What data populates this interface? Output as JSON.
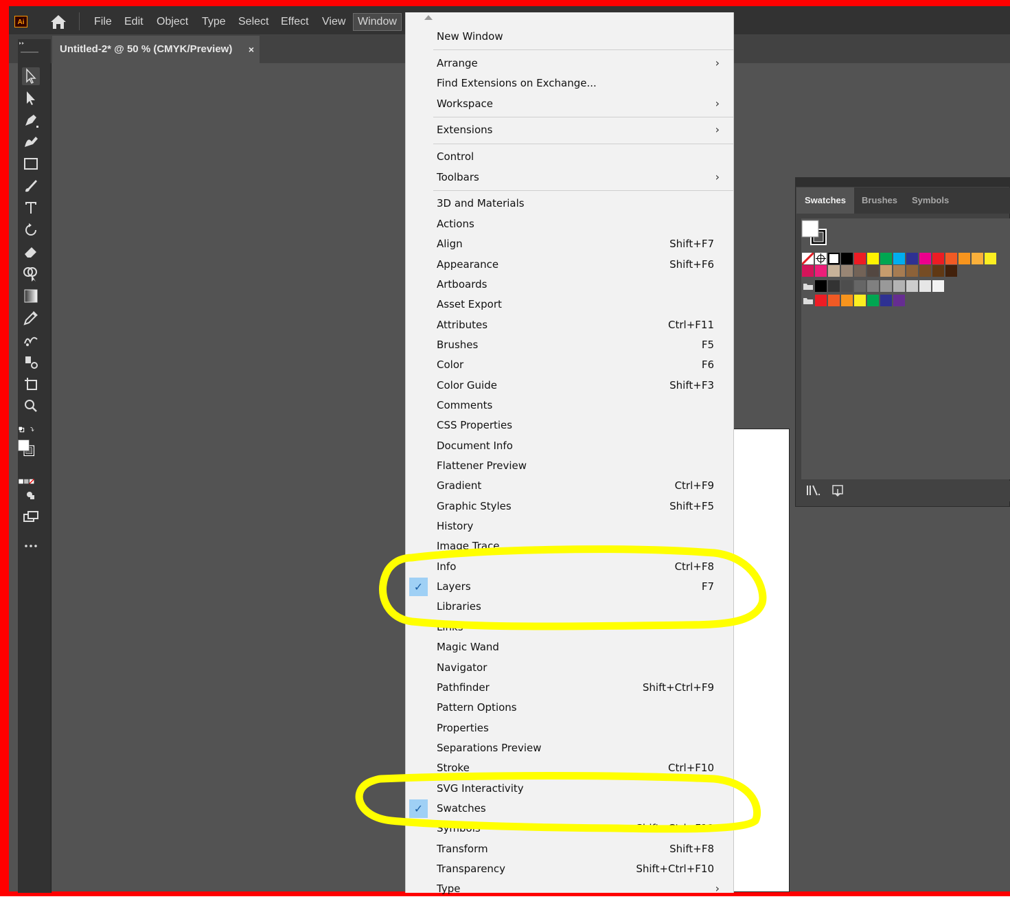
{
  "app": {
    "logo_text": "Ai",
    "menu": [
      "File",
      "Edit",
      "Object",
      "Type",
      "Select",
      "Effect",
      "View",
      "Window"
    ]
  },
  "document_tab": {
    "title": "Untitled-2* @ 50 % (CMYK/Preview)",
    "close": "×"
  },
  "swatches_panel": {
    "tabs": [
      "Swatches",
      "Brushes",
      "Symbols"
    ],
    "colors_row1": [
      "#e31e24",
      "#ffffff",
      "#ffffff",
      "#000000",
      "#ed1c24",
      "#fff200",
      "#00a651",
      "#00aeef",
      "#2e3192",
      "#ec008c",
      "#ed1c24",
      "#f15a24",
      "#f7941d",
      "#fbb03b",
      "#fcee21"
    ],
    "colors_row2": [
      "#d4145a",
      "#ed1e79",
      "#c7b299",
      "#998675",
      "#736357",
      "#534741",
      "#c69c6d",
      "#a67c52",
      "#8c6239",
      "#754c24",
      "#603813",
      "#42210b"
    ],
    "colors_row3": [
      "#000000",
      "#333333",
      "#4d4d4d",
      "#666666",
      "#808080",
      "#999999",
      "#b3b3b3",
      "#cccccc",
      "#e6e6e6",
      "#f2f2f2"
    ],
    "colors_row4": [
      "#ed1c24",
      "#f15a24",
      "#f7941d",
      "#fcee21",
      "#00a651",
      "#2e3192",
      "#662d91"
    ]
  },
  "window_menu": {
    "items": [
      {
        "label": "New Window",
        "shortcut": "",
        "submenu": false,
        "checked": false
      },
      {
        "label": "Arrange",
        "shortcut": "",
        "submenu": true,
        "checked": false
      },
      {
        "label": "Find Extensions on Exchange...",
        "shortcut": "",
        "submenu": false,
        "checked": false
      },
      {
        "label": "Workspace",
        "shortcut": "",
        "submenu": true,
        "checked": false
      },
      {
        "label": "Extensions",
        "shortcut": "",
        "submenu": true,
        "checked": false
      },
      {
        "label": "Control",
        "shortcut": "",
        "submenu": false,
        "checked": false
      },
      {
        "label": "Toolbars",
        "shortcut": "",
        "submenu": true,
        "checked": false
      },
      {
        "label": "3D and Materials",
        "shortcut": "",
        "submenu": false,
        "checked": false
      },
      {
        "label": "Actions",
        "shortcut": "",
        "submenu": false,
        "checked": false
      },
      {
        "label": "Align",
        "shortcut": "Shift+F7",
        "submenu": false,
        "checked": false
      },
      {
        "label": "Appearance",
        "shortcut": "Shift+F6",
        "submenu": false,
        "checked": false
      },
      {
        "label": "Artboards",
        "shortcut": "",
        "submenu": false,
        "checked": false
      },
      {
        "label": "Asset Export",
        "shortcut": "",
        "submenu": false,
        "checked": false
      },
      {
        "label": "Attributes",
        "shortcut": "Ctrl+F11",
        "submenu": false,
        "checked": false
      },
      {
        "label": "Brushes",
        "shortcut": "F5",
        "submenu": false,
        "checked": false
      },
      {
        "label": "Color",
        "shortcut": "F6",
        "submenu": false,
        "checked": false
      },
      {
        "label": "Color Guide",
        "shortcut": "Shift+F3",
        "submenu": false,
        "checked": false
      },
      {
        "label": "Comments",
        "shortcut": "",
        "submenu": false,
        "checked": false
      },
      {
        "label": "CSS Properties",
        "shortcut": "",
        "submenu": false,
        "checked": false
      },
      {
        "label": "Document Info",
        "shortcut": "",
        "submenu": false,
        "checked": false
      },
      {
        "label": "Flattener Preview",
        "shortcut": "",
        "submenu": false,
        "checked": false
      },
      {
        "label": "Gradient",
        "shortcut": "Ctrl+F9",
        "submenu": false,
        "checked": false
      },
      {
        "label": "Graphic Styles",
        "shortcut": "Shift+F5",
        "submenu": false,
        "checked": false
      },
      {
        "label": "History",
        "shortcut": "",
        "submenu": false,
        "checked": false
      },
      {
        "label": "Image Trace",
        "shortcut": "",
        "submenu": false,
        "checked": false
      },
      {
        "label": "Info",
        "shortcut": "Ctrl+F8",
        "submenu": false,
        "checked": false
      },
      {
        "label": "Layers",
        "shortcut": "F7",
        "submenu": false,
        "checked": true
      },
      {
        "label": "Libraries",
        "shortcut": "",
        "submenu": false,
        "checked": false
      },
      {
        "label": "Links",
        "shortcut": "",
        "submenu": false,
        "checked": false
      },
      {
        "label": "Magic Wand",
        "shortcut": "",
        "submenu": false,
        "checked": false
      },
      {
        "label": "Navigator",
        "shortcut": "",
        "submenu": false,
        "checked": false
      },
      {
        "label": "Pathfinder",
        "shortcut": "Shift+Ctrl+F9",
        "submenu": false,
        "checked": false
      },
      {
        "label": "Pattern Options",
        "shortcut": "",
        "submenu": false,
        "checked": false
      },
      {
        "label": "Properties",
        "shortcut": "",
        "submenu": false,
        "checked": false
      },
      {
        "label": "Separations Preview",
        "shortcut": "",
        "submenu": false,
        "checked": false
      },
      {
        "label": "Stroke",
        "shortcut": "Ctrl+F10",
        "submenu": false,
        "checked": false
      },
      {
        "label": "SVG Interactivity",
        "shortcut": "",
        "submenu": false,
        "checked": false
      },
      {
        "label": "Swatches",
        "shortcut": "",
        "submenu": false,
        "checked": true
      },
      {
        "label": "Symbols",
        "shortcut": "Shift+Ctrl+F11",
        "submenu": false,
        "checked": false
      },
      {
        "label": "Transform",
        "shortcut": "Shift+F8",
        "submenu": false,
        "checked": false
      },
      {
        "label": "Transparency",
        "shortcut": "Shift+Ctrl+F10",
        "submenu": false,
        "checked": false
      },
      {
        "label": "Type",
        "shortcut": "",
        "submenu": true,
        "checked": false
      }
    ]
  },
  "annotation_color": "#ffff00",
  "border_color": "#ff0000"
}
